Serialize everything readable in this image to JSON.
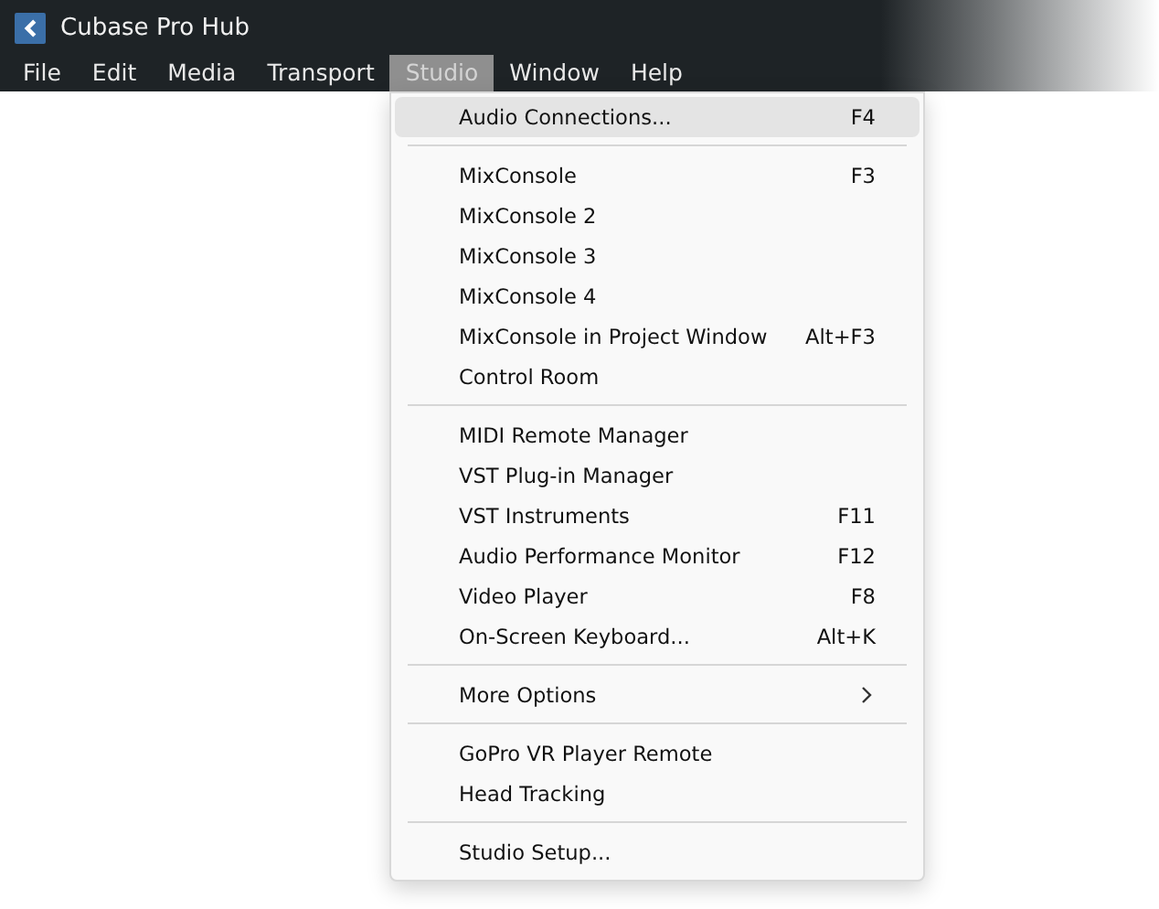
{
  "window": {
    "title": "Cubase Pro Hub"
  },
  "menu_bar": [
    {
      "label": "File",
      "selected": false
    },
    {
      "label": "Edit",
      "selected": false
    },
    {
      "label": "Media",
      "selected": false
    },
    {
      "label": "Transport",
      "selected": false
    },
    {
      "label": "Studio",
      "selected": true
    },
    {
      "label": "Window",
      "selected": false
    },
    {
      "label": "Help",
      "selected": false
    }
  ],
  "dropdown": {
    "sections": [
      {
        "items": [
          {
            "label": "Audio Connections...",
            "shortcut": "F4",
            "selected": true
          }
        ]
      },
      {
        "items": [
          {
            "label": "MixConsole",
            "shortcut": "F3",
            "selected": false
          },
          {
            "label": "MixConsole 2",
            "selected": false
          },
          {
            "label": "MixConsole 3",
            "selected": false
          },
          {
            "label": "MixConsole 4",
            "selected": false
          },
          {
            "label": "MixConsole in Project Window",
            "shortcut": "Alt+F3",
            "selected": false
          },
          {
            "label": "Control Room",
            "selected": false
          }
        ]
      },
      {
        "items": [
          {
            "label": "MIDI Remote Manager",
            "selected": false
          },
          {
            "label": "VST Plug-in Manager",
            "selected": false
          },
          {
            "label": "VST Instruments",
            "shortcut": "F11",
            "selected": false
          },
          {
            "label": "Audio Performance Monitor",
            "shortcut": "F12",
            "selected": false
          },
          {
            "label": "Video Player",
            "shortcut": "F8",
            "selected": false
          },
          {
            "label": "On-Screen Keyboard...",
            "shortcut": "Alt+K",
            "selected": false
          }
        ]
      },
      {
        "items": [
          {
            "label": "More Options",
            "submenu": true,
            "selected": false
          }
        ]
      },
      {
        "items": [
          {
            "label": "GoPro VR Player Remote",
            "selected": false
          },
          {
            "label": "Head Tracking",
            "selected": false
          }
        ]
      },
      {
        "items": [
          {
            "label": "Studio Setup...",
            "selected": false
          }
        ]
      }
    ]
  }
}
